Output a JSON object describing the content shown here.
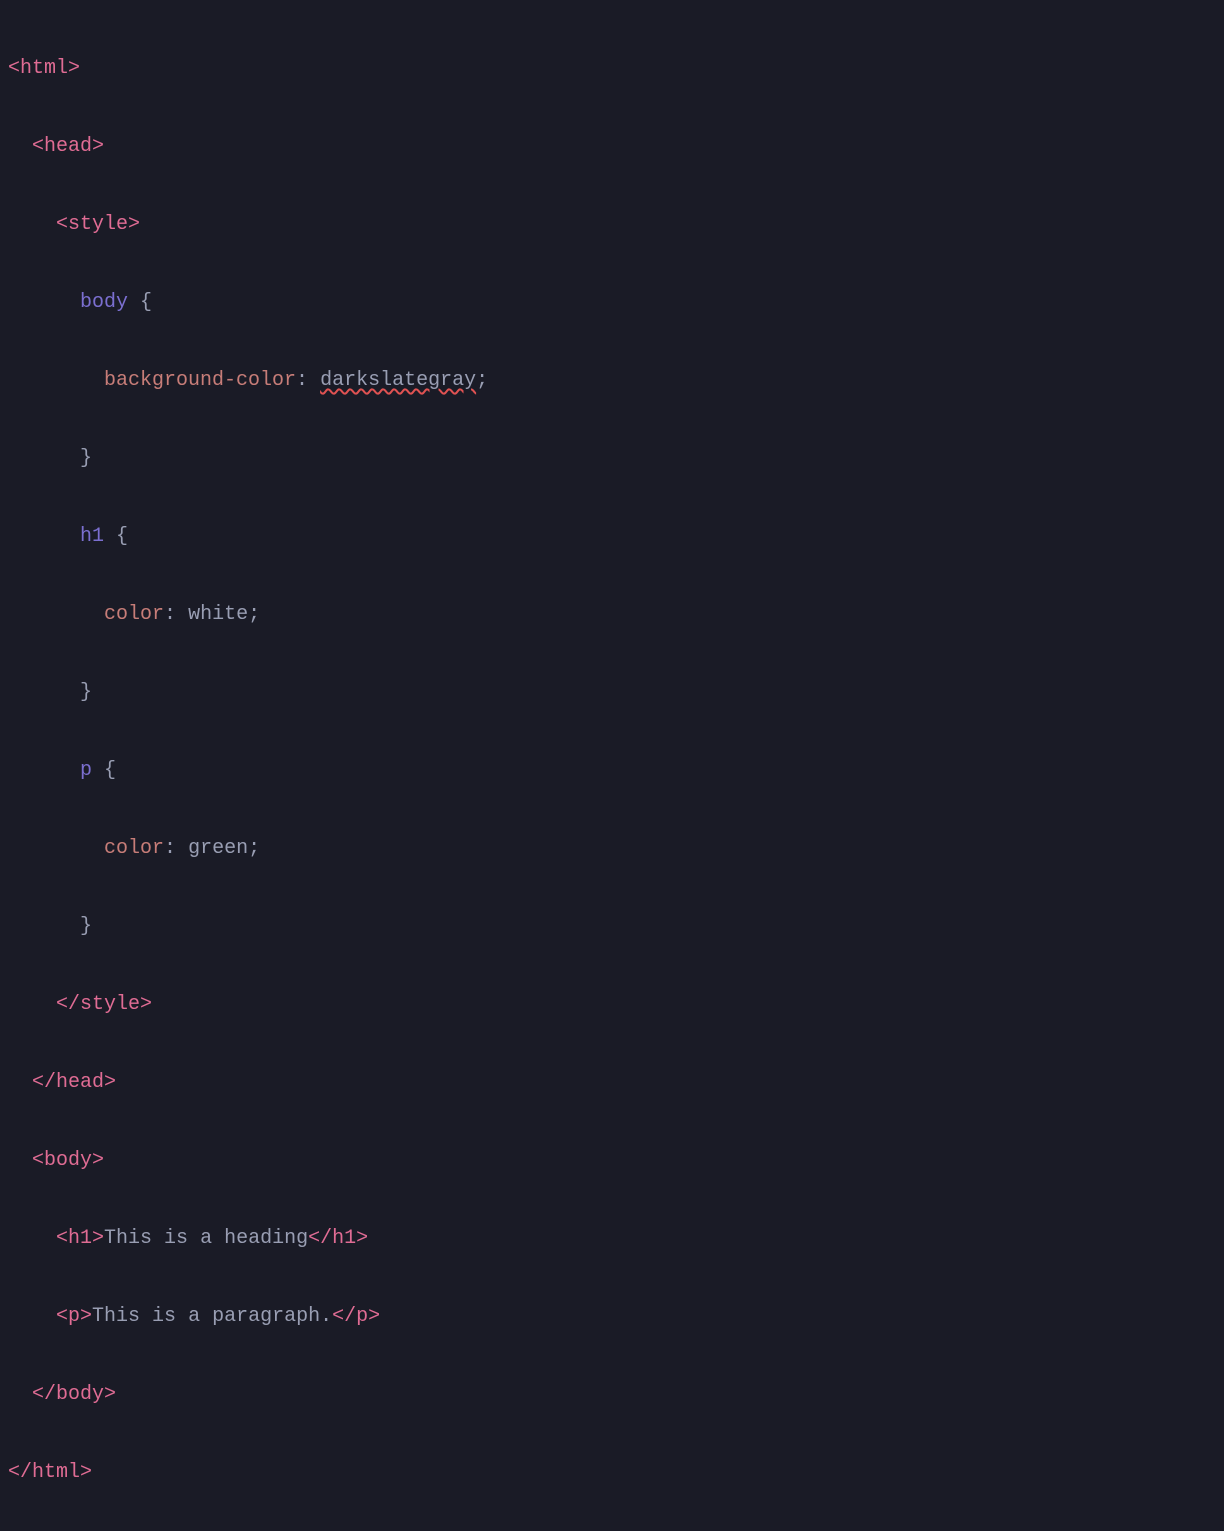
{
  "code": {
    "tags": {
      "html_open": "html",
      "html_close": "html",
      "head_open": "head",
      "head_close": "head",
      "style_open": "style",
      "style_close": "style",
      "body_open": "body",
      "body_close": "body",
      "h1_open": "h1",
      "h1_close": "h1",
      "p_open": "p",
      "p_close": "p"
    },
    "brackets": {
      "open": "<",
      "close": ">",
      "slash_open": "</"
    },
    "css": {
      "selectors": {
        "body": "body",
        "h1": "h1",
        "p": "p"
      },
      "braces": {
        "open": "{",
        "close": "}"
      },
      "rules": {
        "bg_prop": "background-color",
        "bg_val": "darkslategray",
        "color_prop": "color",
        "h1_color_val": "white",
        "p_color_val": "green"
      },
      "colon": ":",
      "semi": ";"
    },
    "content": {
      "h1_text": "This is a heading",
      "p_text": "This is a paragraph."
    }
  }
}
